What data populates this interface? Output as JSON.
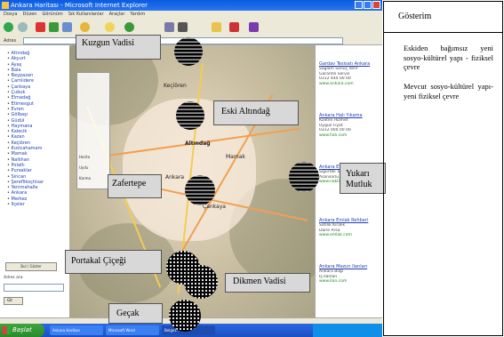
{
  "window": {
    "title": "Ankara Haritası - Microsoft Internet Explorer",
    "menu": [
      "Dosya",
      "Düzen",
      "Görünüm",
      "Sık Kullanılanlar",
      "Araçlar",
      "Yardım"
    ],
    "address_label": "Adres"
  },
  "left_panel": {
    "districts": [
      "Altındağ",
      "Akyurt",
      "Ayaş",
      "Bala",
      "Beypazarı",
      "Çamlıdere",
      "Çankaya",
      "Çubuk",
      "Elmadağ",
      "Etimesgut",
      "Evren",
      "Gölbaşı",
      "Güdül",
      "Haymana",
      "Kalecik",
      "Kazan",
      "Keçiören",
      "Kızılcahamam",
      "Mamak",
      "Nallıhan",
      "Polatlı",
      "Pursaklar",
      "Sincan",
      "Şereflikoçhisar",
      "Yenimahalle",
      "Ankara",
      "Merkez",
      "Ilçeler"
    ],
    "button_label": "Bul / Göster",
    "search_label": "Adres ara",
    "go_label": "Git"
  },
  "map": {
    "center_label": "Altındağ",
    "other_labels": [
      "Ankara",
      "Çankaya",
      "Keçiören",
      "Mamak"
    ],
    "zoom_options": [
      "Harita",
      "Uydu",
      "Karma"
    ]
  },
  "right_panel": {
    "entries": [
      {
        "title": "Gardav Tesisatı Ankara",
        "lines": [
          "Sağlam Sonuç Verir",
          "Garantili Servis",
          "0312 444 00 00"
        ],
        "link": "www.ankara.com"
      },
      {
        "title": "Ankara Halı Yıkama",
        "lines": [
          "Kaliteli Hizmet",
          "Uygun Fiyat",
          "0312 000 00 00"
        ],
        "link": "www.halı.com"
      },
      {
        "title": "Ankara Evden Eve",
        "lines": [
          "Sigortalı Taşıma",
          "Asansörlü Hizmet"
        ],
        "link": "www.nakliyat.com"
      },
      {
        "title": "Ankara Emlak Rehberi",
        "lines": [
          "Satılık Kiralık",
          "Daire Arsa"
        ],
        "link": "www.emlak.com"
      },
      {
        "title": "Ankara Mezun Ilanları",
        "lines": [
          "Ankara Bilgi",
          "İş Ilanları"
        ],
        "link": "www.ilan.com"
      }
    ]
  },
  "taskbar": {
    "start_label": "Başlat",
    "tasks": [
      "Ankara Haritası",
      "Microsoft Word",
      "Belge1"
    ]
  },
  "overlay_labels": {
    "kuzgun": "Kuzgun Vadisi",
    "eski_altindag": "Eski Altındağ",
    "zafertepe": "Zafertepe",
    "yukari_mutluk": "Yukarı Mutluk",
    "portakal": "Portakal Çiçeği",
    "dikmen": "Dikmen Vadisi",
    "gecak": "Geçak"
  },
  "legend": {
    "header": "Gösterim",
    "items": [
      "Eskiden bağımsız yeni sosyo-kültürel yapı - fiziksel çevre",
      "Mevcut sosyo-kültürel yapı- yeni fiziksel çevre"
    ]
  },
  "colors": {
    "xp_blue": "#2a76ee",
    "label_bg": "#d8d8d8",
    "marker_fill": "#000000"
  }
}
